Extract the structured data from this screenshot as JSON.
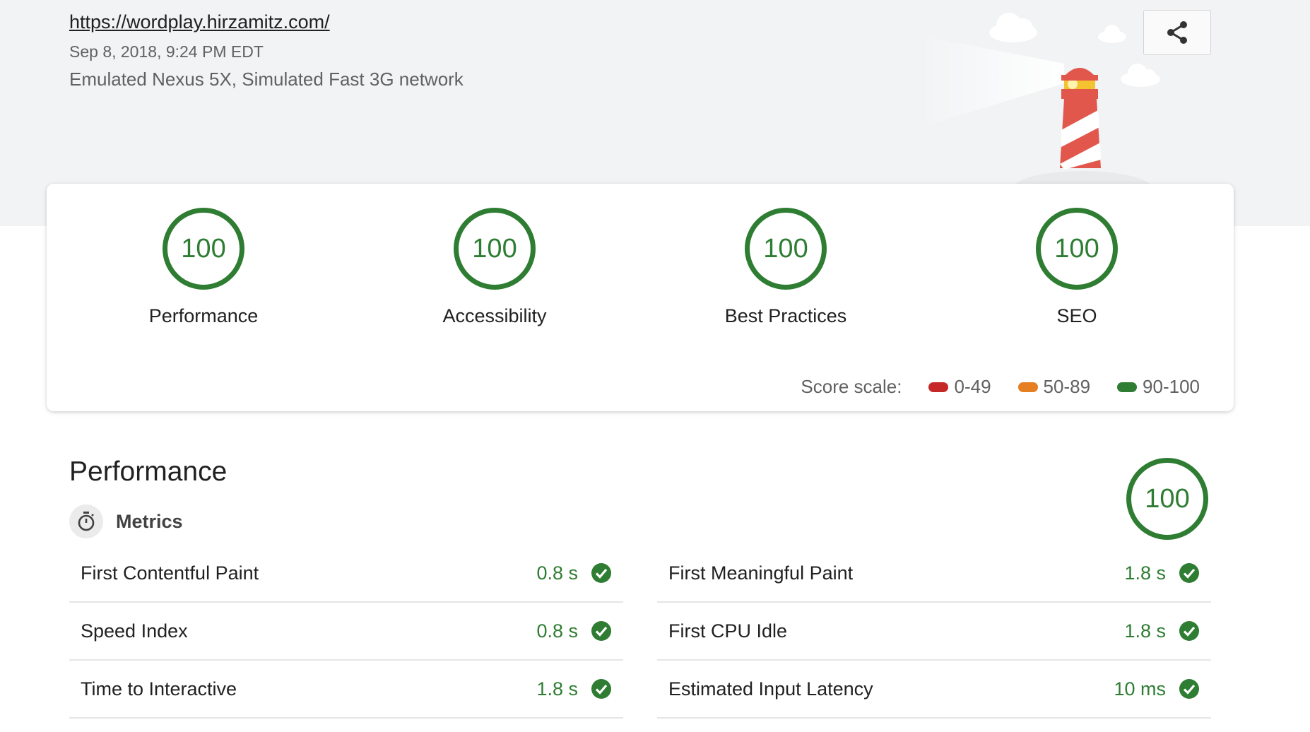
{
  "header": {
    "url": "https://wordplay.hirzamitz.com/",
    "date": "Sep 8, 2018, 9:24 PM EDT",
    "environment": "Emulated Nexus 5X, Simulated Fast 3G network",
    "share_icon": "share-icon"
  },
  "categories": [
    {
      "label": "Performance",
      "score": "100"
    },
    {
      "label": "Accessibility",
      "score": "100"
    },
    {
      "label": "Best Practices",
      "score": "100"
    },
    {
      "label": "SEO",
      "score": "100"
    }
  ],
  "score_scale": {
    "title": "Score scale:",
    "ranges": [
      {
        "label": "0-49",
        "color": "#c62828"
      },
      {
        "label": "50-89",
        "color": "#e67e22"
      },
      {
        "label": "90-100",
        "color": "#2e7d32"
      }
    ]
  },
  "performance": {
    "title": "Performance",
    "score": "100",
    "metrics_label": "Metrics",
    "metrics_icon": "stopwatch-icon",
    "metrics": [
      {
        "name": "First Contentful Paint",
        "value": "0.8 s"
      },
      {
        "name": "First Meaningful Paint",
        "value": "1.8 s"
      },
      {
        "name": "Speed Index",
        "value": "0.8 s"
      },
      {
        "name": "First CPU Idle",
        "value": "1.8 s"
      },
      {
        "name": "Time to Interactive",
        "value": "1.8 s"
      },
      {
        "name": "Estimated Input Latency",
        "value": "10 ms"
      }
    ],
    "status_icon": "check-circle-icon"
  },
  "colors": {
    "pass": "#2e7d32",
    "header_bg": "#f1f3f4"
  }
}
